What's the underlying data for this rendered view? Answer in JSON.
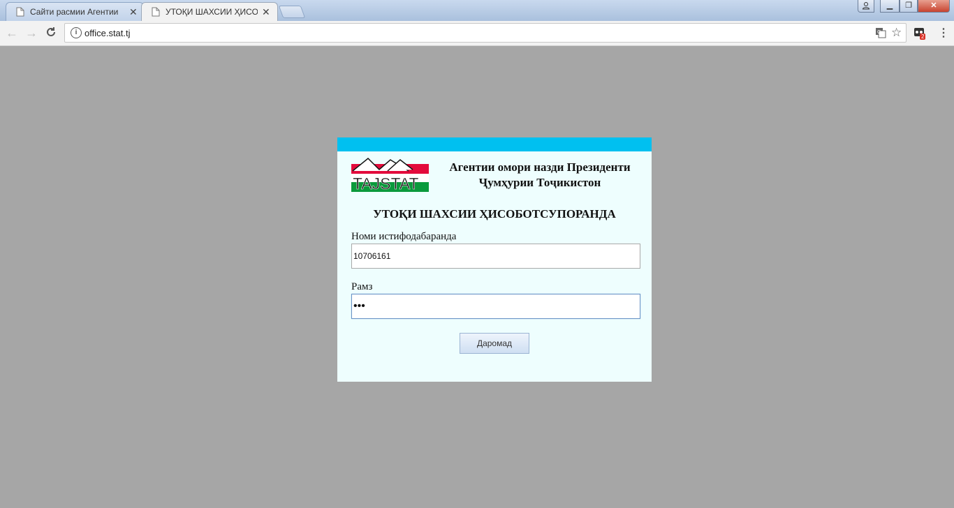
{
  "browser": {
    "tabs": [
      {
        "title": "Сайти расмии Агентии",
        "active": false
      },
      {
        "title": "УТОҚИ ШАХСИИ ҲИСОБ",
        "active": true
      }
    ],
    "url": "office.stat.tj",
    "extension_badge": "2",
    "accent_color": "#a9c0dd"
  },
  "page": {
    "logo_text": "TAJSTAT",
    "org_line1": "Агентии омори назди Президенти",
    "org_line2": "Ҷумҳурии Тоҷикистон",
    "title": "УТОҚИ ШАХСИИ ҲИСОБОТСУПОРАНДА",
    "username_label": "Номи истифодабаранда",
    "username_value": "10706161",
    "password_label": "Рамз",
    "password_value": "•••",
    "submit_label": "Даромад",
    "header_color": "#00c0f0",
    "panel_color": "#eefefe"
  }
}
